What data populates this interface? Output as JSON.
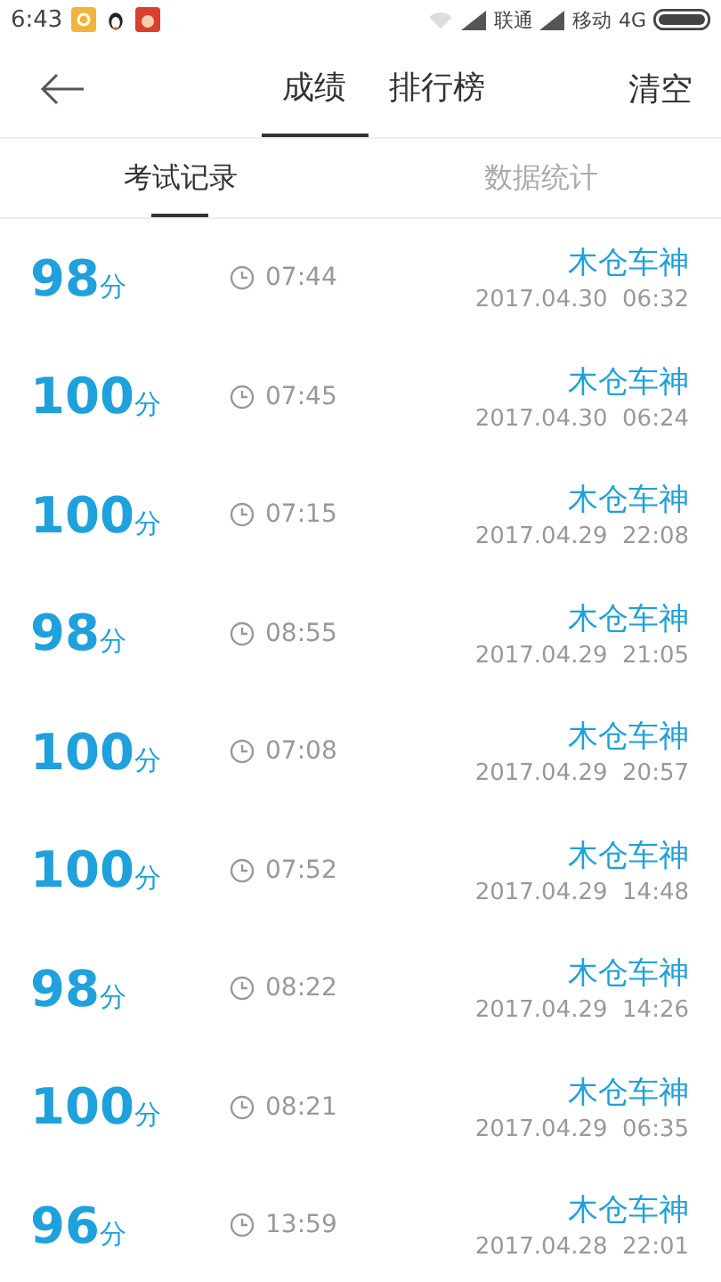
{
  "status_bar": {
    "time": "6:43",
    "carrier_1": "联通",
    "carrier_2": "移动",
    "network": "4G"
  },
  "header": {
    "tabs": [
      {
        "label": "成绩",
        "selected": true
      },
      {
        "label": "排行榜",
        "selected": false
      }
    ],
    "action": "清空"
  },
  "sub_tabs": [
    {
      "label": "考试记录",
      "selected": true
    },
    {
      "label": "数据统计",
      "selected": false
    }
  ],
  "records": [
    {
      "score": "98",
      "unit": "分",
      "duration": "07:44",
      "name": "木仓车神",
      "datetime": "2017.04.30  06:32"
    },
    {
      "score": "100",
      "unit": "分",
      "duration": "07:45",
      "name": "木仓车神",
      "datetime": "2017.04.30  06:24"
    },
    {
      "score": "100",
      "unit": "分",
      "duration": "07:15",
      "name": "木仓车神",
      "datetime": "2017.04.29  22:08"
    },
    {
      "score": "98",
      "unit": "分",
      "duration": "08:55",
      "name": "木仓车神",
      "datetime": "2017.04.29  21:05"
    },
    {
      "score": "100",
      "unit": "分",
      "duration": "07:08",
      "name": "木仓车神",
      "datetime": "2017.04.29  20:57"
    },
    {
      "score": "100",
      "unit": "分",
      "duration": "07:52",
      "name": "木仓车神",
      "datetime": "2017.04.29  14:48"
    },
    {
      "score": "98",
      "unit": "分",
      "duration": "08:22",
      "name": "木仓车神",
      "datetime": "2017.04.29  14:26"
    },
    {
      "score": "100",
      "unit": "分",
      "duration": "08:21",
      "name": "木仓车神",
      "datetime": "2017.04.29  06:35"
    },
    {
      "score": "96",
      "unit": "分",
      "duration": "13:59",
      "name": "木仓车神",
      "datetime": "2017.04.28  22:01"
    }
  ]
}
